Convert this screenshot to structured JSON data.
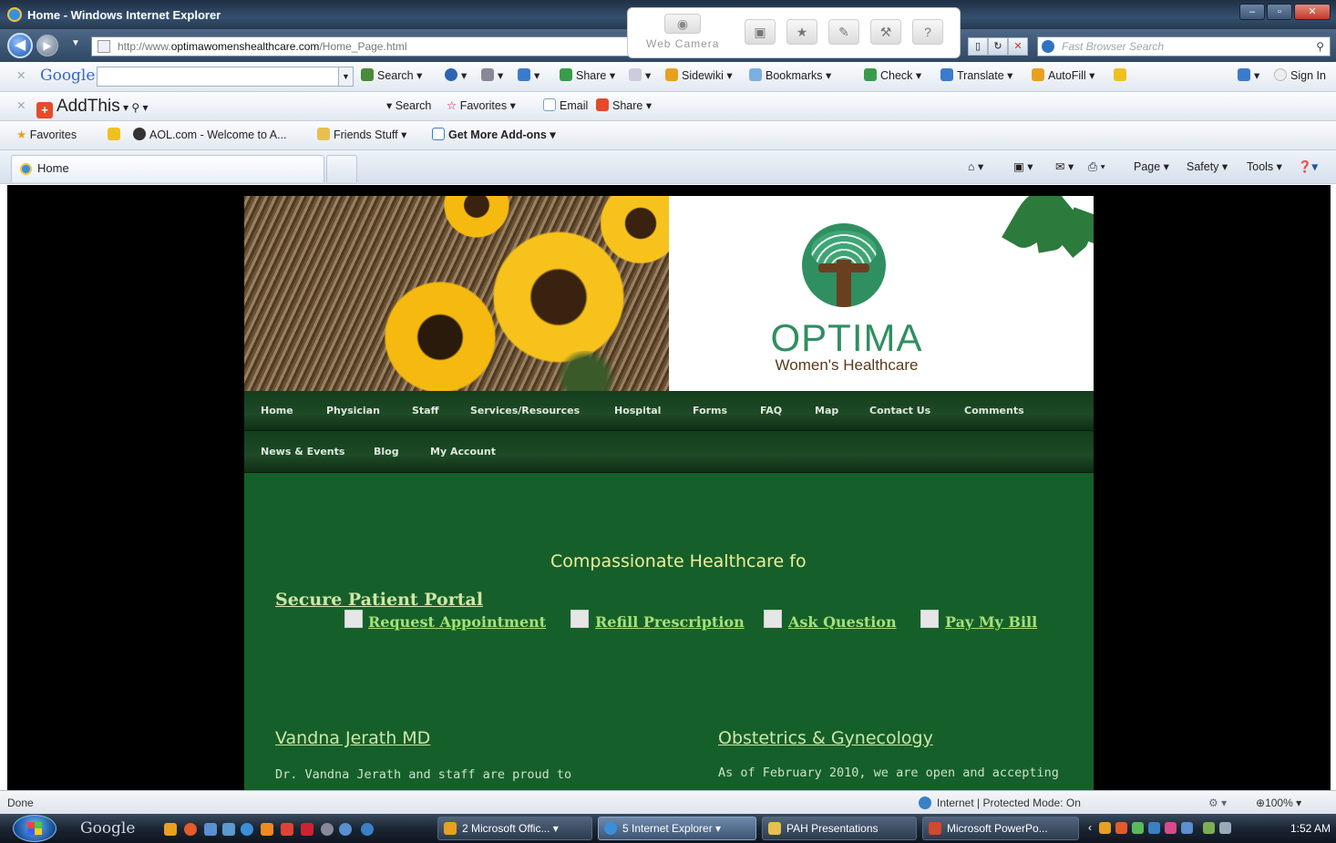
{
  "window": {
    "title": "Home - Windows Internet Explorer"
  },
  "navbar": {
    "address_prefix": "http://www.",
    "address_domain": "optimawomenshealthcare.com",
    "address_path": "/Home_Page.html",
    "popup_label": "Web Camera",
    "search_placeholder": "Fast Browser Search"
  },
  "google_toolbar": {
    "logo": "Google",
    "items": [
      {
        "label": "Search ▾"
      },
      {
        "label": "Share ▾"
      },
      {
        "label": "Sidewiki ▾"
      },
      {
        "label": "Bookmarks ▾"
      },
      {
        "label": "Check ▾"
      },
      {
        "label": "Translate ▾"
      },
      {
        "label": "AutoFill ▾"
      }
    ],
    "sign_in": "Sign In"
  },
  "addthis_toolbar": {
    "logo": "AddThis",
    "search": "Search",
    "favorites": "Favorites",
    "email": "Email",
    "share": "Share ▾"
  },
  "favorites_bar": {
    "favorites": "Favorites",
    "items": [
      {
        "label": "AOL.com - Welcome to A..."
      },
      {
        "label": "Friends Stuff ▾"
      },
      {
        "label": "Get More Add-ons ▾"
      }
    ]
  },
  "tabs": {
    "active": "Home",
    "command_bar": [
      {
        "label": "Page ▾"
      },
      {
        "label": "Safety ▾"
      },
      {
        "label": "Tools ▾"
      }
    ]
  },
  "site": {
    "brand": "OPTIMA",
    "brand_sub": "Women's Healthcare",
    "menu_row1": [
      "Home",
      "Physician",
      "Staff",
      "Services/Resources",
      "Hospital",
      "Forms",
      "FAQ",
      "Map",
      "Contact Us",
      "Comments"
    ],
    "menu_row2": [
      "News & Events",
      "Blog",
      "My Account"
    ],
    "headline": "Compassionate Healthcare fo",
    "portal": "Secure Patient Portal",
    "quick_links": [
      "Request Appointment",
      "Refill Prescription",
      "Ask Question",
      "Pay My Bill"
    ],
    "col_left_title": "Vandna Jerath MD",
    "col_left_text": "Dr. Vandna Jerath and staff are proud to",
    "col_right_title": "Obstetrics & Gynecology",
    "col_right_text": "As of February 2010, we are open and accepting"
  },
  "statusbar": {
    "status": "Done",
    "zone": "Internet | Protected Mode: On",
    "zoom": "100%"
  },
  "taskbar": {
    "google": "Google",
    "tasks": [
      {
        "label": "2 Microsoft Offic... ▾"
      },
      {
        "label": "5 Internet Explorer ▾"
      },
      {
        "label": "PAH Presentations"
      },
      {
        "label": "Microsoft PowerPo..."
      }
    ],
    "clock": "1:52 AM"
  },
  "colors": {
    "site_green": "#15602a",
    "menu_dark_green": "#123e1c",
    "brand_teal": "#2f8f61",
    "link_green": "#a6e07a"
  }
}
